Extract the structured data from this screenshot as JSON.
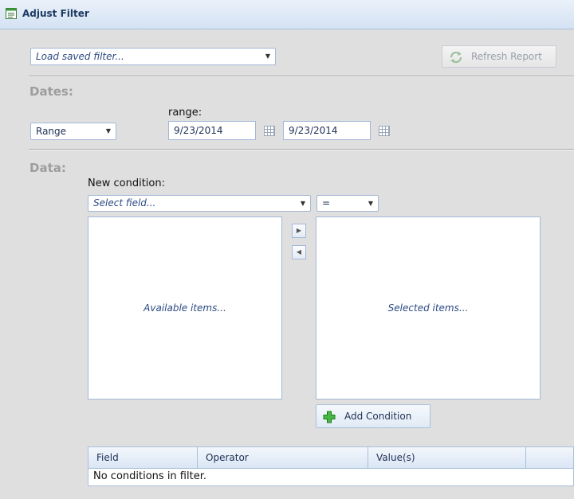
{
  "window": {
    "title": "Adjust Filter"
  },
  "toolbar": {
    "saved_filter_placeholder": "Load saved filter...",
    "refresh_label": "Refresh Report"
  },
  "dates": {
    "section_label": "Dates:",
    "range_label": "range:",
    "mode_value": "Range",
    "start_date": "9/23/2014",
    "end_date": "9/23/2014"
  },
  "data": {
    "section_label": "Data:",
    "new_condition_label": "New condition:",
    "field_placeholder": "Select field...",
    "operator_value": "=",
    "available_placeholder": "Available items...",
    "selected_placeholder": "Selected items...",
    "add_condition_label": "Add Condition"
  },
  "conditions_table": {
    "columns": [
      "Field",
      "Operator",
      "Value(s)",
      ""
    ],
    "empty_message": "No conditions in filter."
  },
  "icons": {
    "window": "filter-list-icon",
    "refresh": "refresh-icon",
    "calendar": "calendar-icon",
    "add": "plus-icon"
  },
  "colors": {
    "title_bar": "#d4e2f3",
    "accent_text": "#1e3b63",
    "section_label": "#9d9d9d",
    "add_icon_green": "#3aa838"
  }
}
